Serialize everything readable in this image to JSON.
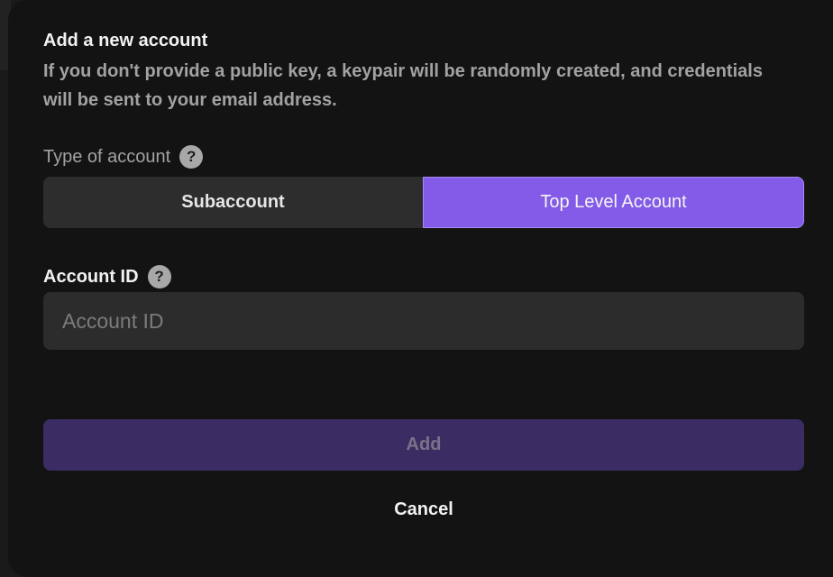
{
  "modal": {
    "title": "Add a new account",
    "description": "If you don't provide a public key, a keypair will be randomly created, and credentials will be sent to your email address."
  },
  "account_type": {
    "label": "Type of account",
    "help_icon": "question-mark-circle-icon",
    "help_glyph": "?",
    "options": [
      {
        "label": "Subaccount",
        "selected": false
      },
      {
        "label": "Top Level Account",
        "selected": true
      }
    ],
    "selected_color": "#845ae8"
  },
  "account_id": {
    "label": "Account ID",
    "help_icon": "question-mark-circle-icon",
    "help_glyph": "?",
    "value": "",
    "placeholder": "Account ID"
  },
  "actions": {
    "add_label": "Add",
    "add_disabled": true,
    "cancel_label": "Cancel"
  }
}
